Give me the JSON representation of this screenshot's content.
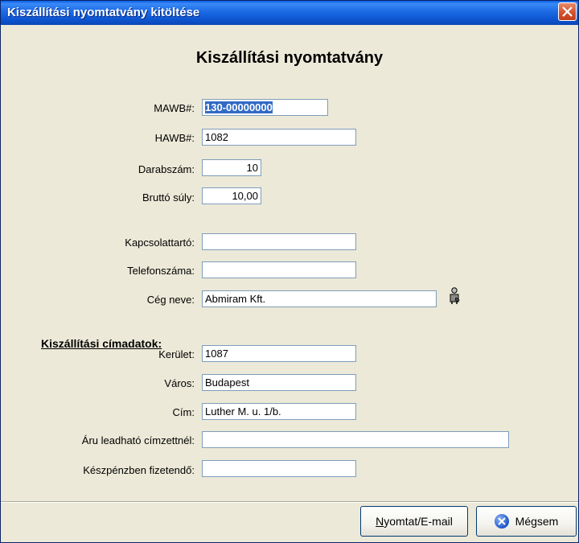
{
  "window": {
    "title": "Kiszállítási nyomtatvány kitöltése"
  },
  "form": {
    "title": "Kiszállítási nyomtatvány",
    "mawb": {
      "label": "MAWB#:",
      "value": "130-00000000"
    },
    "hawb": {
      "label": "HAWB#:",
      "value": "1082"
    },
    "pieces": {
      "label": "Darabszám:",
      "value": "10"
    },
    "gross_weight": {
      "label": "Bruttó súly:",
      "value": "10,00"
    },
    "contact": {
      "label": "Kapcsolattartó:",
      "value": ""
    },
    "phone": {
      "label": "Telefonszáma:",
      "value": ""
    },
    "company": {
      "label": "Cég neve:",
      "value": "Abmiram Kft.",
      "lookup_icon": "person-icon"
    },
    "address_section": "Kiszállítási címadatok:",
    "district": {
      "label": "Kerület:",
      "value": "1087"
    },
    "city": {
      "label": "Város:",
      "value": "Budapest"
    },
    "address": {
      "label": "Cím:",
      "value": "Luther M. u. 1/b."
    },
    "recipient": {
      "label": "Áru leadható címzettnél:",
      "value": ""
    },
    "cash_payable": {
      "label": "Készpénzben fizetendő:",
      "value": ""
    }
  },
  "buttons": {
    "print_email_underline": "N",
    "print_email_rest": "yomtat/E-mail",
    "cancel": "Mégsem"
  }
}
